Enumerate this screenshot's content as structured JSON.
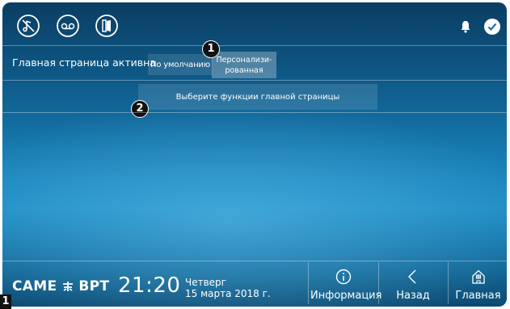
{
  "top_bar": {
    "icons": [
      "mute-icon",
      "voicemail-icon",
      "door-open-icon"
    ],
    "status_icons": [
      "bell-icon",
      "check-icon"
    ]
  },
  "settings": {
    "homepage_label": "Главная страница активна",
    "default_button": "По умолчанию",
    "custom_button_line1": "Персонализи-",
    "custom_button_line2": "рованная",
    "select_functions_button": "Выберите функции главной страницы"
  },
  "callouts": {
    "one": "1",
    "two": "2"
  },
  "footer": {
    "brand_left": "CAME",
    "brand_right": "BPT",
    "time": "21:20",
    "weekday": "Четверг",
    "date": "15 марта 2018 г.",
    "info_label": "Информация",
    "back_label": "Назад",
    "home_label": "Главная"
  },
  "figure_label": "1"
}
